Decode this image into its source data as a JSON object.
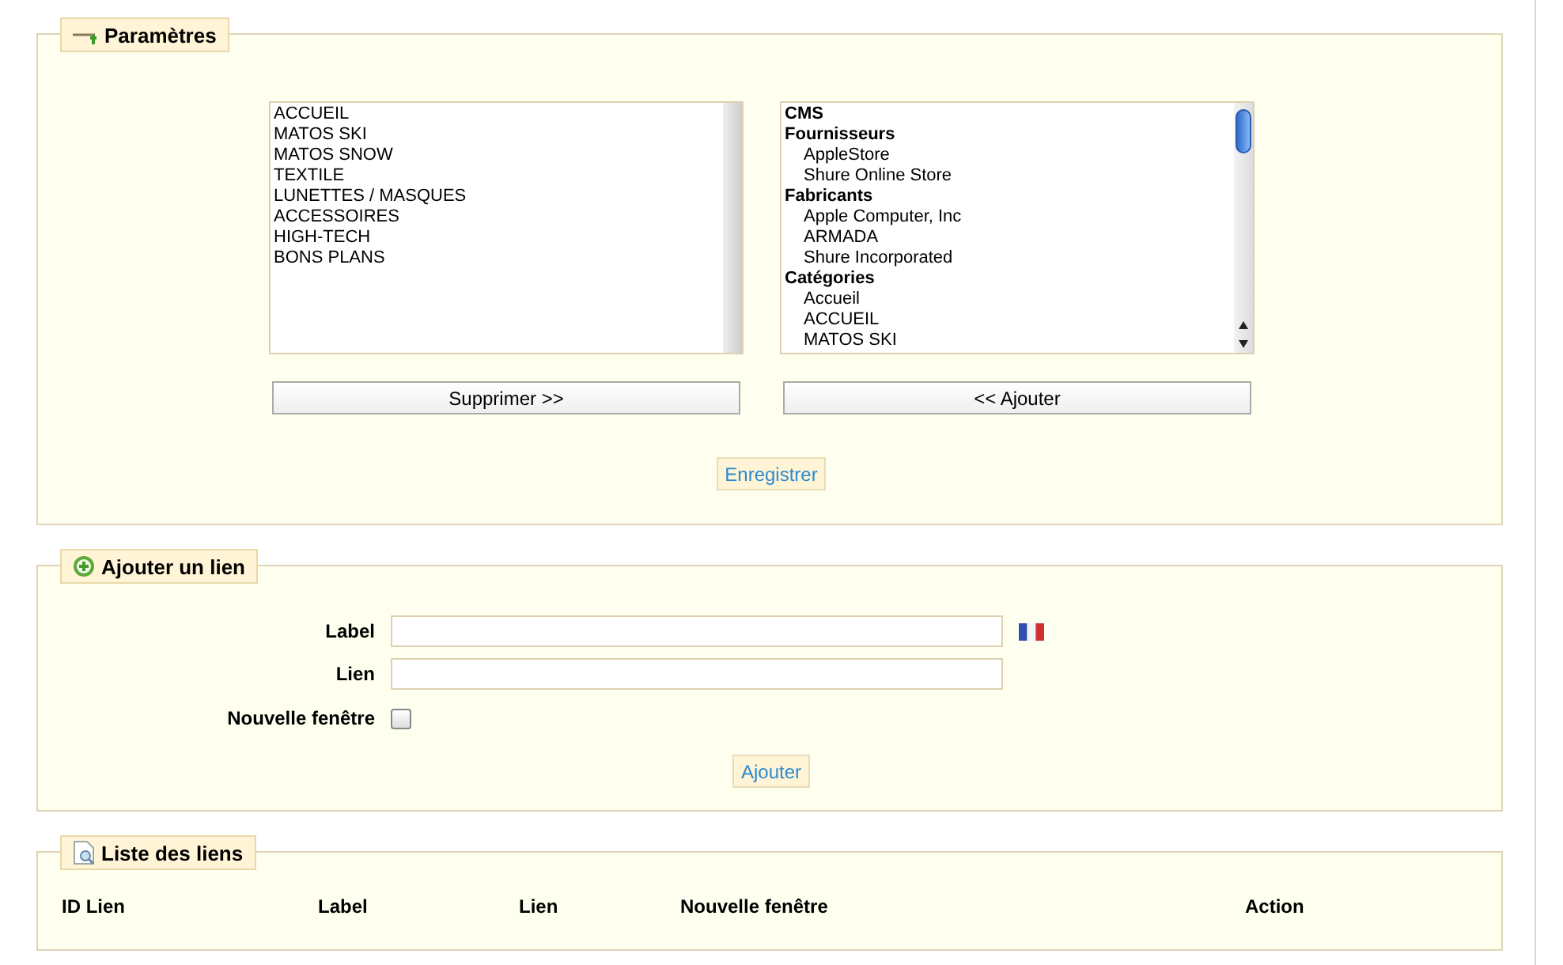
{
  "parametres": {
    "title": "Paramètres",
    "selected_list": [
      "ACCUEIL",
      "MATOS SKI",
      "MATOS SNOW",
      "TEXTILE",
      "LUNETTES / MASQUES",
      "ACCESSOIRES",
      "HIGH-TECH",
      "BONS PLANS"
    ],
    "available_list": [
      {
        "kind": "group",
        "label": "CMS"
      },
      {
        "kind": "group",
        "label": "Fournisseurs"
      },
      {
        "kind": "option",
        "label": "AppleStore"
      },
      {
        "kind": "option",
        "label": "Shure Online Store"
      },
      {
        "kind": "group",
        "label": "Fabricants"
      },
      {
        "kind": "option",
        "label": "Apple Computer, Inc"
      },
      {
        "kind": "option",
        "label": "ARMADA"
      },
      {
        "kind": "option",
        "label": "Shure Incorporated"
      },
      {
        "kind": "group",
        "label": "Catégories"
      },
      {
        "kind": "option",
        "label": "Accueil"
      },
      {
        "kind": "option",
        "label": "ACCUEIL"
      },
      {
        "kind": "option",
        "label": "MATOS SKI"
      }
    ],
    "remove_button": "Supprimer >>",
    "add_button": "<< Ajouter",
    "save_button": "Enregistrer"
  },
  "add_link": {
    "title": "Ajouter un lien",
    "label_field": "Label",
    "link_field": "Lien",
    "new_window": {
      "label": "Nouvelle fenêtre",
      "checked": false
    },
    "submit_button": "Ajouter"
  },
  "link_list": {
    "title": "Liste des liens",
    "columns": [
      "ID Lien",
      "Label",
      "Lien",
      "Nouvelle fenêtre",
      "Action"
    ]
  }
}
